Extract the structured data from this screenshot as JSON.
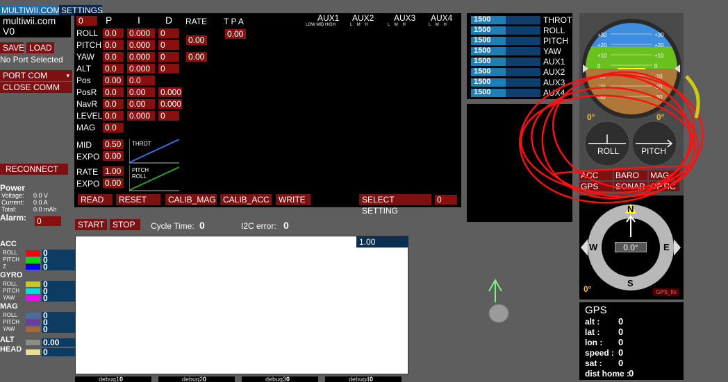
{
  "tabs": {
    "multiwii": "MULTIWII.COM",
    "settings": "SETTINGS"
  },
  "version": {
    "title": "multiwii.com",
    "ver": "V0"
  },
  "buttons": {
    "save": "SAVE",
    "load": "LOAD",
    "port_status": "No Port Selected",
    "port_com": "PORT COM",
    "close_comm": "CLOSE COMM",
    "reconnect": "RECONNECT"
  },
  "power": {
    "title": "Power",
    "voltage_label": "Voltage:",
    "voltage": "0.0 V",
    "current_label": "Current:",
    "current": "0.0 A",
    "total_label": "Total:",
    "total": "0.0 mAh",
    "alarm_label": "Alarm:",
    "alarm": "0"
  },
  "pid": {
    "headers": {
      "p": "P",
      "i": "I",
      "d": "D",
      "rate": "RATE",
      "tpa": "T P A",
      "corner": "0"
    },
    "rows": [
      {
        "name": "ROLL",
        "p": "0.0",
        "i": "0.000",
        "d": "0"
      },
      {
        "name": "PITCH",
        "p": "0.0",
        "i": "0.000",
        "d": "0"
      },
      {
        "name": "YAW",
        "p": "0.0",
        "i": "0.000",
        "d": "0"
      },
      {
        "name": "ALT",
        "p": "0.0",
        "i": "0.000",
        "d": "0"
      },
      {
        "name": "Pos",
        "p": "0.00",
        "i": "0.0",
        "d": ""
      },
      {
        "name": "PosR",
        "p": "0.0",
        "i": "0.00",
        "d": "0.000"
      },
      {
        "name": "NavR",
        "p": "0.0",
        "i": "0.00",
        "d": "0.000"
      },
      {
        "name": "LEVEL",
        "p": "0.0",
        "i": "0.000",
        "d": "0"
      },
      {
        "name": "MAG",
        "p": "0.0",
        "i": "",
        "d": ""
      }
    ],
    "rate_roll_pitch": "0.00",
    "rate_yaw": "0.00",
    "tpa": "0.00"
  },
  "throttle": {
    "mid_label": "MID",
    "mid": "0.50",
    "expo_label": "EXPO",
    "expo": "0.00",
    "graph_label": "THROT"
  },
  "rc_rate": {
    "rate_label": "RATE",
    "rate": "1.00",
    "expo_label": "EXPO",
    "expo": "0.00",
    "graph_label1": "PITCH",
    "graph_label2": "ROLL"
  },
  "aux": {
    "labels": [
      "AUX1",
      "AUX2",
      "AUX3",
      "AUX4"
    ],
    "sub1": "LOW MID HIGH",
    "sub": "L    M    H"
  },
  "bottom_buttons": {
    "read": "READ",
    "reset": "RESET",
    "calib_mag": "CALIB_MAG",
    "calib_acc": "CALIB_ACC",
    "write": "WRITE",
    "select_setting": "SELECT SETTING",
    "setting_val": "0"
  },
  "rc": [
    {
      "name": "THROT",
      "value": "1500",
      "level": 0.5
    },
    {
      "name": "ROLL",
      "value": "1500",
      "level": 0.5
    },
    {
      "name": "PITCH",
      "value": "1500",
      "level": 0.5
    },
    {
      "name": "YAW",
      "value": "1500",
      "level": 0.5
    },
    {
      "name": "AUX1",
      "value": "1500",
      "level": 0.5
    },
    {
      "name": "AUX2",
      "value": "1500",
      "level": 0.5
    },
    {
      "name": "AUX3",
      "value": "1500",
      "level": 0.5
    },
    {
      "name": "AUX4",
      "value": "1500",
      "level": 0.5
    }
  ],
  "horizon": {
    "ticks_left": [
      "+30",
      "+20",
      "+10",
      "0",
      "-10",
      "-20",
      "-30"
    ],
    "ticks_right": [
      "+30",
      "+20",
      "+10",
      "0",
      "-10",
      "-20",
      "-30"
    ],
    "roll_deg": "0°",
    "pitch_deg": "0°",
    "roll_label": "ROLL",
    "pitch_label": "PITCH"
  },
  "sensors_status": {
    "acc": "ACC",
    "baro": "BARO",
    "mag": "MAG",
    "gps": "GPS",
    "sonar": "SONAR",
    "optic": "OPTIC"
  },
  "compass": {
    "n": "N",
    "s": "S",
    "e": "E",
    "w": "W",
    "heading": "0.0°",
    "deg": "0°",
    "gps_fix": "GPS_fix"
  },
  "gps": {
    "title": "GPS",
    "alt_label": "alt  :",
    "alt": "0",
    "lat_label": "lat  :",
    "lat": "0",
    "lon_label": "lon  :",
    "lon": "0",
    "speed_label": "speed :",
    "speed": "0",
    "sat_label": "sat  :",
    "sat": "0",
    "dist_label": "dist home :",
    "dist": "0"
  },
  "graph": {
    "start": "START",
    "stop": "STOP",
    "cycle_label": "Cycle Time:",
    "cycle": "0",
    "i2c_label": "I2C error:",
    "i2c": "0",
    "scale": "1.00"
  },
  "sensors": {
    "acc": {
      "title": "ACC",
      "rows": [
        {
          "name": "ROLL",
          "value": "0",
          "color": "#ff0000"
        },
        {
          "name": "PITCH",
          "value": "0",
          "color": "#00dd00"
        },
        {
          "name": "Z",
          "value": "0",
          "color": "#0000ff"
        }
      ]
    },
    "gyro": {
      "title": "GYRO",
      "rows": [
        {
          "name": "ROLL",
          "value": "0",
          "color": "#c8c820"
        },
        {
          "name": "PITCH",
          "value": "0",
          "color": "#00e0e0"
        },
        {
          "name": "YAW",
          "value": "0",
          "color": "#ff00ff"
        }
      ]
    },
    "mag": {
      "title": "MAG",
      "rows": [
        {
          "name": "ROLL",
          "value": "0",
          "color": "#4a6aa8"
        },
        {
          "name": "PITCH",
          "value": "0",
          "color": "#6a3aa0"
        },
        {
          "name": "YAW",
          "value": "0",
          "color": "#a06a3a"
        }
      ]
    },
    "alt": {
      "title": "ALT",
      "value": "0.00",
      "color": "#8c8c8c"
    },
    "head": {
      "title": "HEAD",
      "value": "0",
      "color": "#e6e08c"
    }
  },
  "debug": [
    {
      "name": "debug1",
      "value": "0"
    },
    {
      "name": "debug2",
      "value": "0"
    },
    {
      "name": "debug3",
      "value": "0"
    },
    {
      "name": "debug4",
      "value": "0"
    }
  ]
}
